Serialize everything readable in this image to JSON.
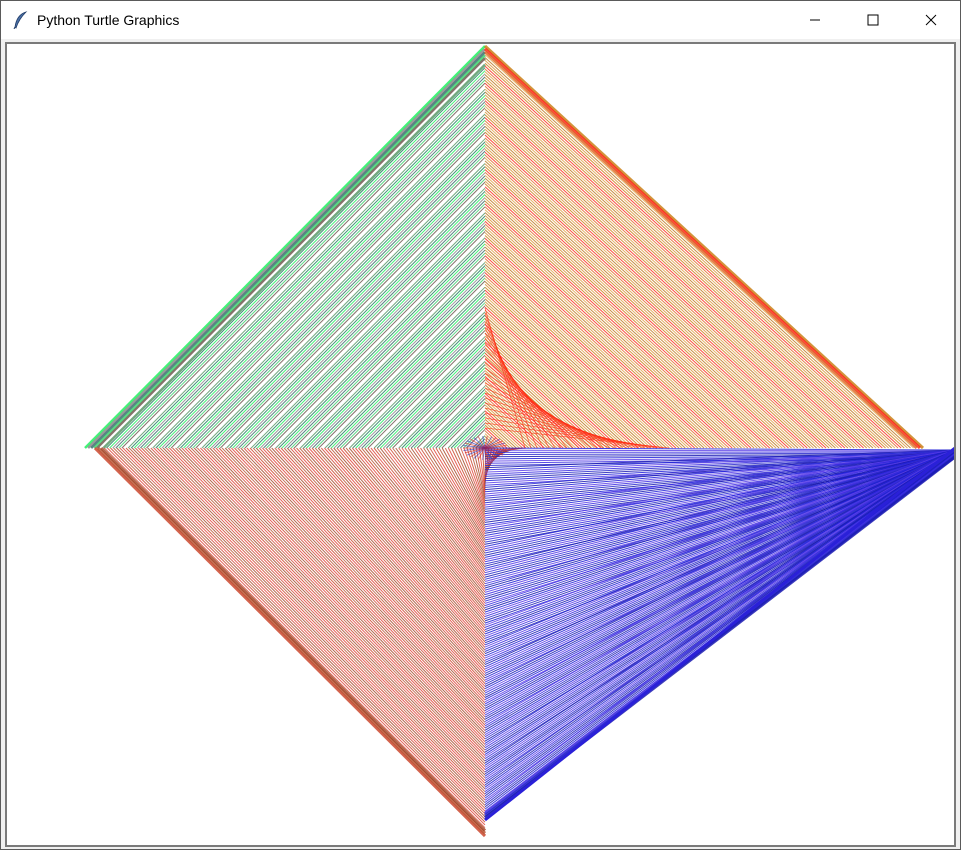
{
  "window": {
    "title": "Python Turtle Graphics",
    "app_icon": "feather-icon",
    "controls": [
      "minimize-icon",
      "maximize-icon",
      "close-icon"
    ]
  },
  "canvas": {
    "background": "#ffffff",
    "quadrants": {
      "top_left": {
        "colors": [
          "#22f060",
          "#3fd070",
          "#5a9a68",
          "#8a8a8a",
          "#6e5a50",
          "#208060",
          "#3c6e6e",
          "#ffffff"
        ]
      },
      "top_right": {
        "colors": [
          "#c8780a",
          "#d89030",
          "#b87018",
          "#e0a040",
          "#e06020",
          "#ff2010"
        ]
      },
      "bottom_left": {
        "colors": [
          "#c83c20",
          "#d04430",
          "#b85030",
          "#e03a30",
          "#a04020"
        ]
      },
      "bottom_right": {
        "colors": [
          "#2020d8",
          "#3a2ae0",
          "#1a1ab0",
          "#5a40e8",
          "#2a2acc"
        ]
      }
    }
  }
}
